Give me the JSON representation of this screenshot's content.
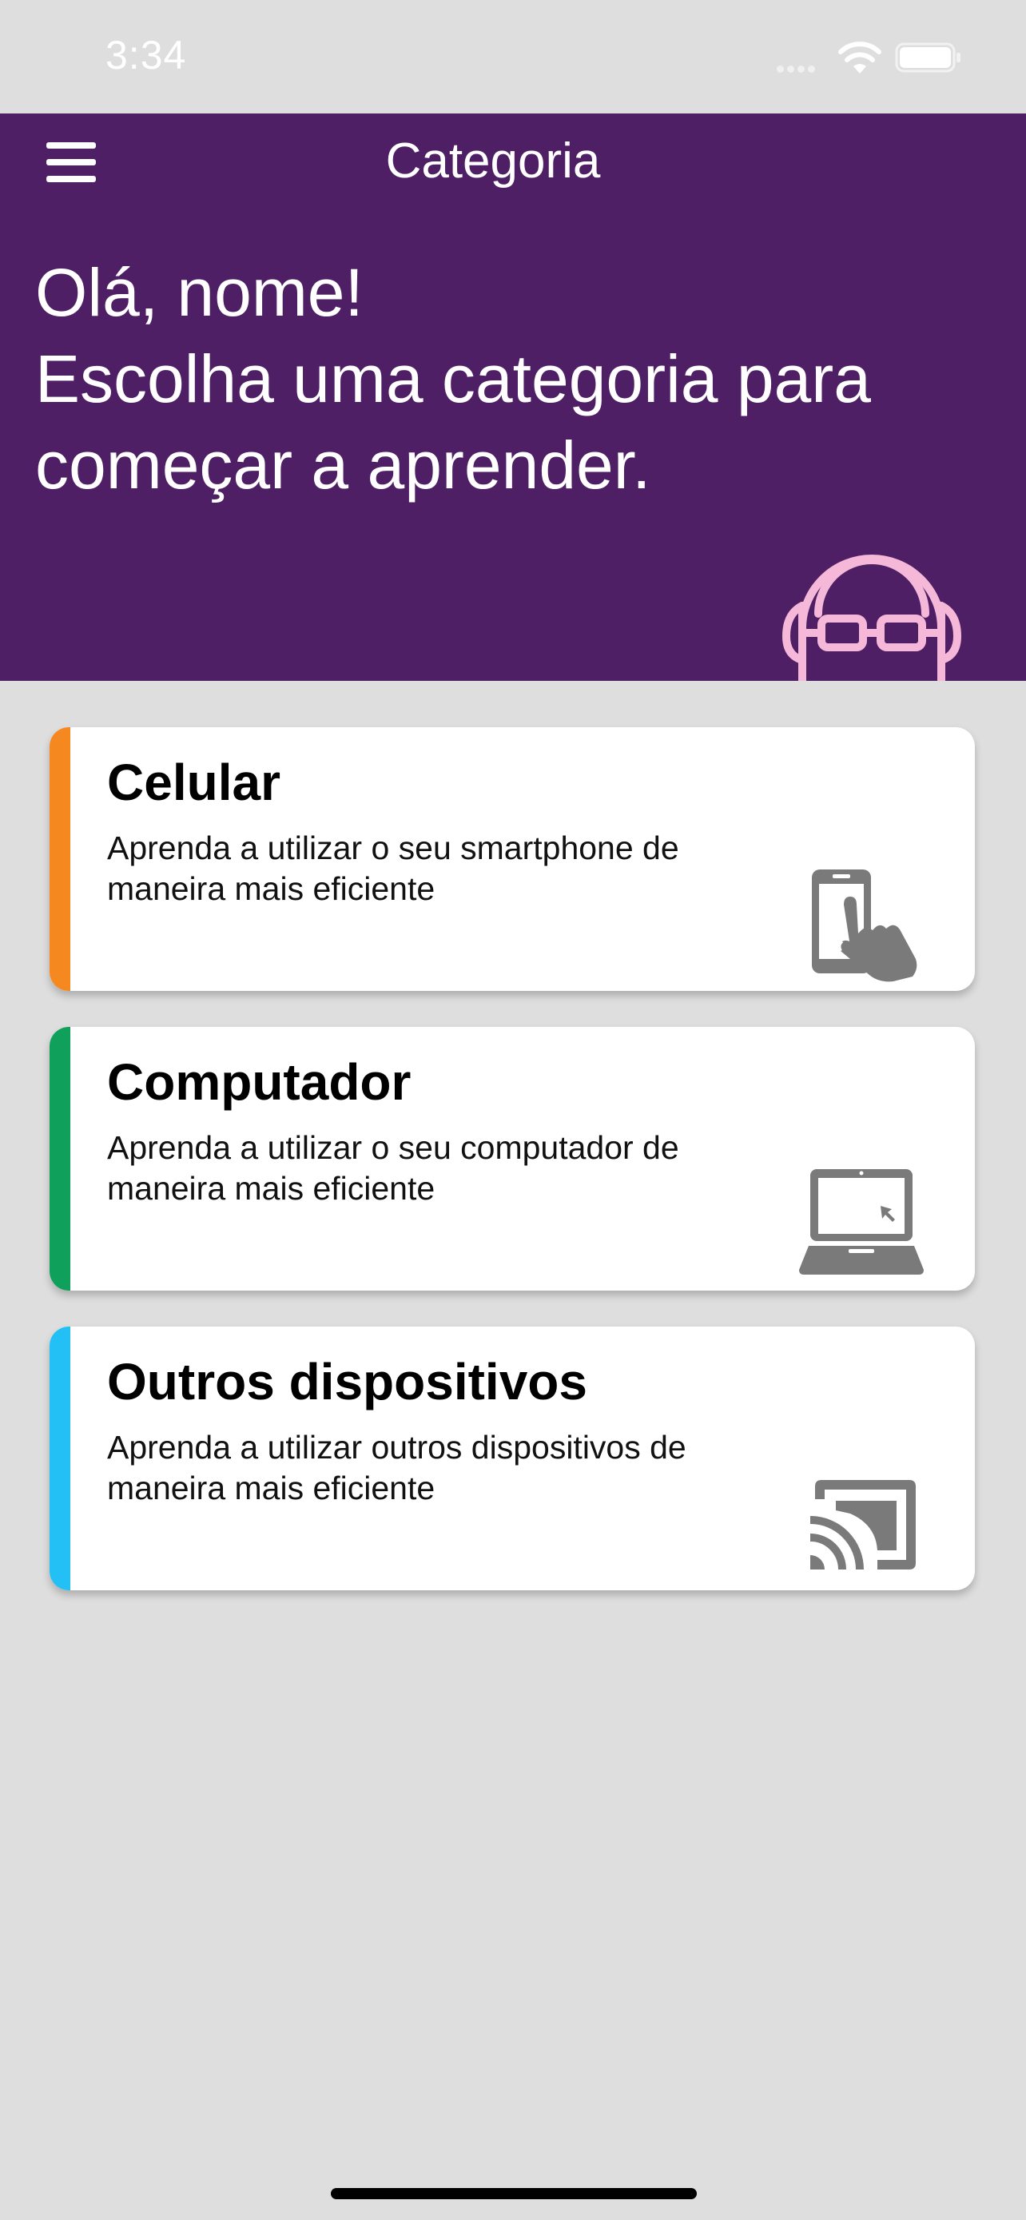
{
  "status_bar": {
    "time": "3:34"
  },
  "header": {
    "title": "Categoria",
    "greeting_line1": "Olá, nome!",
    "greeting_line2": "Escolha uma categoria para",
    "greeting_line3": "começar a aprender."
  },
  "icons": {
    "menu": "menu-icon",
    "mascot": "headphones-mascot-icon",
    "phone": "smartphone-touch-icon",
    "laptop": "laptop-icon",
    "cast": "cast-icon"
  },
  "colors": {
    "header_bg": "#4f1f65",
    "page_bg": "#dedede",
    "mascot_pink": "#f5b8d8",
    "icon_gray": "#7a7a7a"
  },
  "categories": [
    {
      "title": "Celular",
      "desc_line1": "Aprenda a utilizar o seu smartphone de",
      "desc_line2": "maneira mais eficiente",
      "accent": "#f5891f"
    },
    {
      "title": "Computador",
      "desc_line1": "Aprenda a utilizar o seu computador de",
      "desc_line2": "maneira mais eficiente",
      "accent": "#0fa15c"
    },
    {
      "title": "Outros dispositivos",
      "desc_line1": "Aprenda a utilizar outros dispositivos de",
      "desc_line2": "maneira mais eficiente",
      "accent": "#22c0f5"
    }
  ]
}
